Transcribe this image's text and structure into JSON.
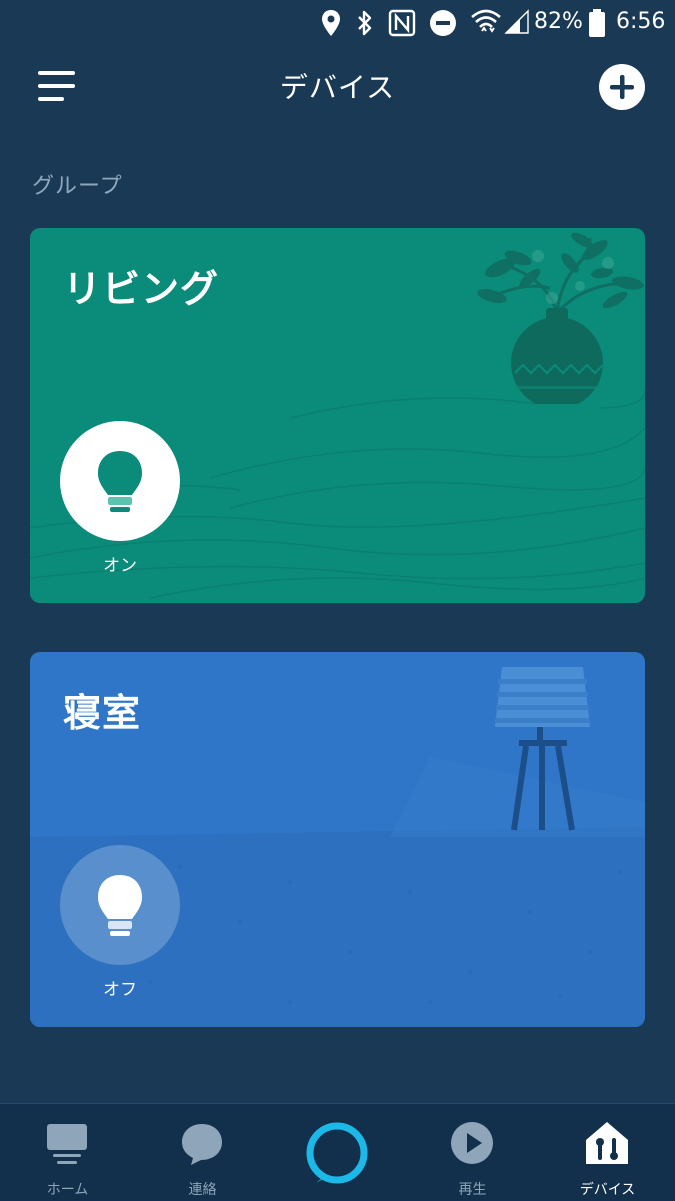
{
  "status_bar": {
    "battery": "82%",
    "time": "6:56",
    "icons": [
      "location-icon",
      "bluetooth-icon",
      "nfc-icon",
      "do-not-disturb-icon",
      "wifi-icon",
      "signal-icon",
      "battery-icon"
    ]
  },
  "header": {
    "title": "デバイス",
    "menu_icon": "hamburger-menu-icon",
    "add_icon": "plus-icon"
  },
  "section": {
    "label": "グループ"
  },
  "groups": [
    {
      "name": "リビング",
      "color": "#0b8b7a",
      "illustration": "plant-vase-icon",
      "device": {
        "icon": "light-bulb-icon",
        "state": "オン"
      }
    },
    {
      "name": "寝室",
      "color": "#2f76c8",
      "illustration": "floor-lamp-icon",
      "device": {
        "icon": "light-bulb-icon",
        "state": "オフ"
      }
    }
  ],
  "bottom_nav": {
    "items": [
      {
        "label": "ホーム",
        "icon": "home-icon",
        "active": false
      },
      {
        "label": "連絡",
        "icon": "chat-bubble-icon",
        "active": false
      },
      {
        "label": "",
        "icon": "alexa-ring-icon",
        "active": false
      },
      {
        "label": "再生",
        "icon": "play-icon",
        "active": false
      },
      {
        "label": "デバイス",
        "icon": "devices-icon",
        "active": true
      }
    ],
    "accent_color": "#1cb8e8"
  }
}
